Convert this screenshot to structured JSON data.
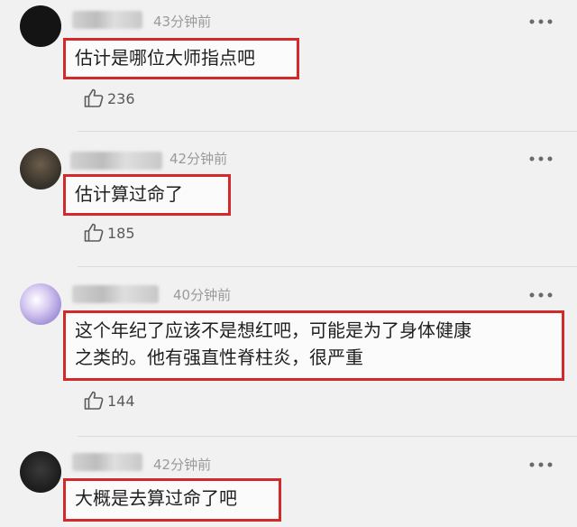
{
  "comments": [
    {
      "time": "43分钟前",
      "text": "估计是哪位大师指点吧",
      "likes": "236",
      "avatar_color": "#141414"
    },
    {
      "time": "42分钟前",
      "text": "估计算过命了",
      "likes": "185",
      "avatar_color": "#4b4438"
    },
    {
      "time": "40分钟前",
      "text": "这个年纪了应该不是想红吧，可能是为了身体健康\n之类的。他有强直性脊柱炎，很严重",
      "likes": "144",
      "avatar_color": "#b9a7df"
    },
    {
      "time": "42分钟前",
      "text": "大概是去算过命了吧",
      "likes": "",
      "avatar_color": "#242424"
    }
  ],
  "icons": {
    "more": "more-dots-icon",
    "like": "thumbs-up-icon"
  },
  "colors": {
    "highlight_border": "#d22a2a",
    "time_text": "#9a9a9a"
  }
}
